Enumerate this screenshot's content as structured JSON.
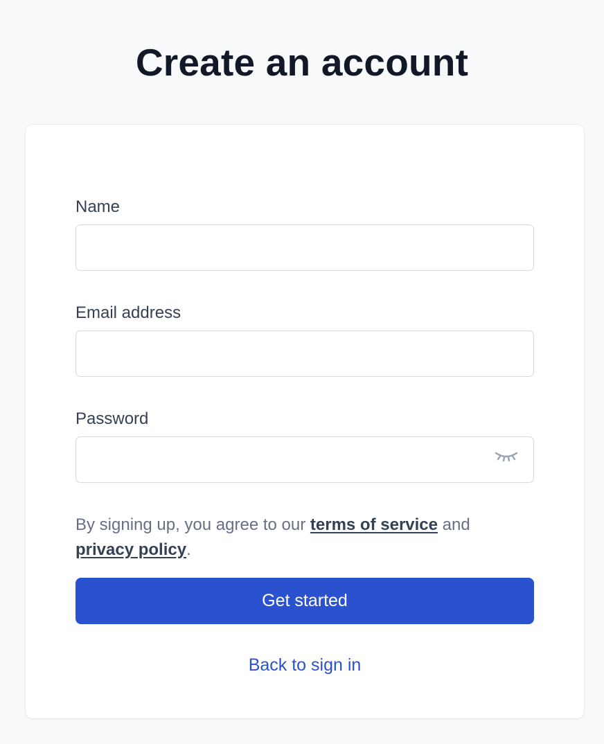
{
  "page": {
    "title": "Create an account"
  },
  "form": {
    "name": {
      "label": "Name",
      "value": "",
      "placeholder": ""
    },
    "email": {
      "label": "Email address",
      "value": "",
      "placeholder": ""
    },
    "password": {
      "label": "Password",
      "value": "",
      "placeholder": "",
      "toggle_icon": "eye-closed-icon"
    },
    "consent": {
      "prefix": "By signing up, you agree to our ",
      "terms_link": "terms of service",
      "middle": " and",
      "privacy_link": "privacy policy",
      "suffix": "."
    },
    "submit_label": "Get started",
    "back_link": "Back to sign in"
  },
  "colors": {
    "background": "#f8f9fb",
    "primary": "#2a52cf",
    "title": "#111827",
    "label": "#344054",
    "muted": "#667085",
    "border": "#d5d9e0"
  }
}
